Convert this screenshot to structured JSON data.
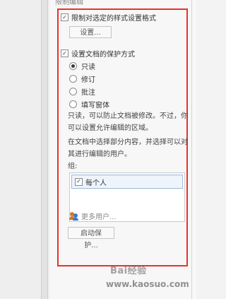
{
  "panel": {
    "header": "限制编辑",
    "section1": {
      "checkbox_label": "限制对选定的样式设置格式",
      "checked": true,
      "settings_button": "设置..."
    },
    "section2": {
      "checkbox_label": "设置文档的保护方式",
      "checked": true,
      "options": [
        "只读",
        "修订",
        "批注",
        "填写窗体"
      ],
      "selected_index": 0,
      "description1": "只读，可以防止文档被修改。不过，你可以设置允许编辑的区域。",
      "description2": "在文档中选择部分内容，并选择可以对其进行编辑的用户。",
      "group_label": "组:",
      "group_items": [
        {
          "label": "每个人",
          "checked": true
        }
      ],
      "more_users": "更多用户...",
      "start_button": "启动保护..."
    }
  },
  "watermark": {
    "brand": "Bai经验",
    "url": "www.kaosuo.com"
  }
}
